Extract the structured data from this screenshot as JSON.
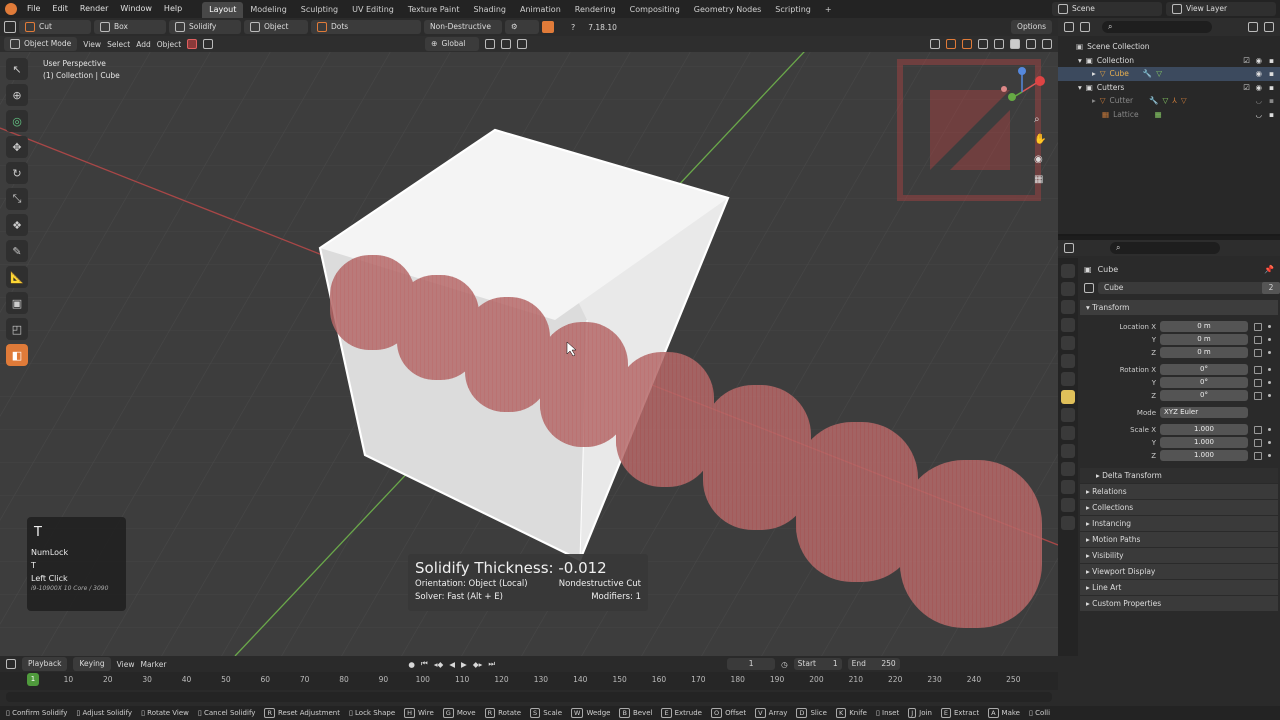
{
  "top_menu": [
    "File",
    "Edit",
    "Render",
    "Window",
    "Help"
  ],
  "workspace_tabs": [
    "Layout",
    "Modeling",
    "Sculpting",
    "UV Editing",
    "Texture Paint",
    "Shading",
    "Animation",
    "Rendering",
    "Compositing",
    "Geometry Nodes",
    "Scripting"
  ],
  "active_workspace": "Layout",
  "scene_label": "Scene",
  "view_layer_label": "View Layer",
  "tool_header": {
    "cut": "Cut",
    "box": "Box",
    "solidify": "Solidify",
    "object": "Object",
    "dots": "Dots",
    "mode": "Non-Destructive",
    "version": "7.18.10",
    "options": "Options"
  },
  "header2": {
    "mode": "Object Mode",
    "view": "View",
    "select": "Select",
    "add": "Add",
    "object": "Object",
    "orientation": "Global"
  },
  "viewport": {
    "perspective": "User Perspective",
    "collection": "(1) Collection | Cube"
  },
  "key_panel": {
    "key": "T",
    "line1": "NumLock",
    "line2": "T",
    "line3": "Left Click",
    "cpu": "i9-10900X 10 Core / 3090"
  },
  "solidify_overlay": {
    "title": "Solidify Thickness: -0.012",
    "orientation": "Orientation: Object (Local)",
    "cut": "Nondestructive Cut",
    "solver": "Solver: Fast (Alt + E)",
    "modifiers": "Modifiers: 1"
  },
  "outliner": {
    "scene_collection": "Scene Collection",
    "items": [
      {
        "label": "Collection",
        "indent": 1
      },
      {
        "label": "Cube",
        "indent": 2
      },
      {
        "label": "Cutters",
        "indent": 1
      },
      {
        "label": "Cutter",
        "indent": 2
      },
      {
        "label": "Lattice",
        "indent": 2
      }
    ]
  },
  "properties": {
    "object_name_breadcrumb": "Cube",
    "object_name": "Cube",
    "user_count": "2",
    "transform_label": "Transform",
    "location_label": "Location X",
    "rotation_label": "Rotation X",
    "scale_label": "Scale X",
    "mode_label": "Mode",
    "location": [
      "0 m",
      "0 m",
      "0 m"
    ],
    "rotation": [
      "0°",
      "0°",
      "0°"
    ],
    "rotation_mode": "XYZ Euler",
    "scale": [
      "1.000",
      "1.000",
      "1.000"
    ],
    "axis_y": "Y",
    "axis_z": "Z",
    "delta_transform": "Delta Transform",
    "sections": [
      "Relations",
      "Collections",
      "Instancing",
      "Motion Paths",
      "Visibility",
      "Viewport Display",
      "Line Art",
      "Custom Properties"
    ]
  },
  "timeline": {
    "playback": "Playback",
    "keying": "Keying",
    "view": "View",
    "marker": "Marker",
    "current_frame": "1",
    "start_label": "Start",
    "start": "1",
    "end_label": "End",
    "end": "250",
    "ticks": [
      "10",
      "20",
      "30",
      "40",
      "50",
      "60",
      "70",
      "80",
      "90",
      "100",
      "110",
      "120",
      "130",
      "140",
      "150",
      "160",
      "170",
      "180",
      "190",
      "200",
      "210",
      "220",
      "230",
      "240",
      "250"
    ],
    "playhead": "1"
  },
  "statusbar": [
    {
      "key": "",
      "label": "Confirm Solidify"
    },
    {
      "key": "",
      "label": "Adjust Solidify"
    },
    {
      "key": "",
      "label": "Rotate View"
    },
    {
      "key": "",
      "label": "Cancel Solidify"
    },
    {
      "key": "R",
      "label": "Reset Adjustment"
    },
    {
      "key": "",
      "label": "Lock Shape"
    },
    {
      "key": "H",
      "label": "Wire"
    },
    {
      "key": "G",
      "label": "Move"
    },
    {
      "key": "R",
      "label": "Rotate"
    },
    {
      "key": "S",
      "label": "Scale"
    },
    {
      "key": "W",
      "label": "Wedge"
    },
    {
      "key": "B",
      "label": "Bevel"
    },
    {
      "key": "E",
      "label": "Extrude"
    },
    {
      "key": "O",
      "label": "Offset"
    },
    {
      "key": "V",
      "label": "Array"
    },
    {
      "key": "D",
      "label": "Slice"
    },
    {
      "key": "K",
      "label": "Knife"
    },
    {
      "key": "",
      "label": "Inset"
    },
    {
      "key": "J",
      "label": "Join"
    },
    {
      "key": "E",
      "label": "Extract"
    },
    {
      "key": "A",
      "label": "Make"
    },
    {
      "key": "",
      "label": "Colli"
    }
  ],
  "colors": {
    "accent": "#e07b39",
    "active_tab": "#484848",
    "cutter_fill": "#c86868",
    "selected_outline": "#ffffff"
  }
}
